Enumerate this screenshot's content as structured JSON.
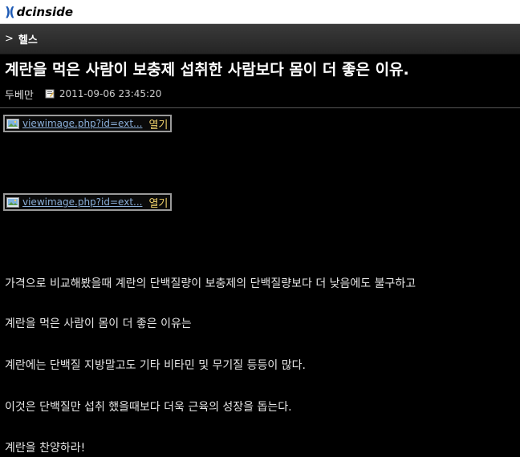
{
  "site": {
    "logo_mark": ")(",
    "logo_text": "dcinside"
  },
  "gallery": {
    "chevron": ">",
    "name": "헬스"
  },
  "post": {
    "title": "계란을 먹은 사람이 보충제 섭취한 사람보다 몸이 더 좋은 이유.",
    "author": "두베만",
    "date": "2011-09-06 23:45:20",
    "images": [
      {
        "link": "viewimage.php?id=ext...",
        "open_label": "열기"
      },
      {
        "link": "viewimage.php?id=ext...",
        "open_label": "열기"
      }
    ],
    "paragraphs": [
      "가격으로 비교해봤을때 계란의 단백질량이 보충제의 단백질량보다 더 낮음에도 불구하고",
      "계란을 먹은 사람이 몸이 더 좋은 이유는",
      "계란에는 단백질 지방말고도 기타 비타민 및 무기질 등등이 많다.",
      "이것은 단백질만 섭취 했을때보다 더욱 근육의 성장을 돕는다.",
      "계란을 찬양하라!"
    ]
  },
  "colors": {
    "link": "#8aaed8",
    "open": "#f2d36b",
    "logo_blue": "#1f5bb5"
  }
}
